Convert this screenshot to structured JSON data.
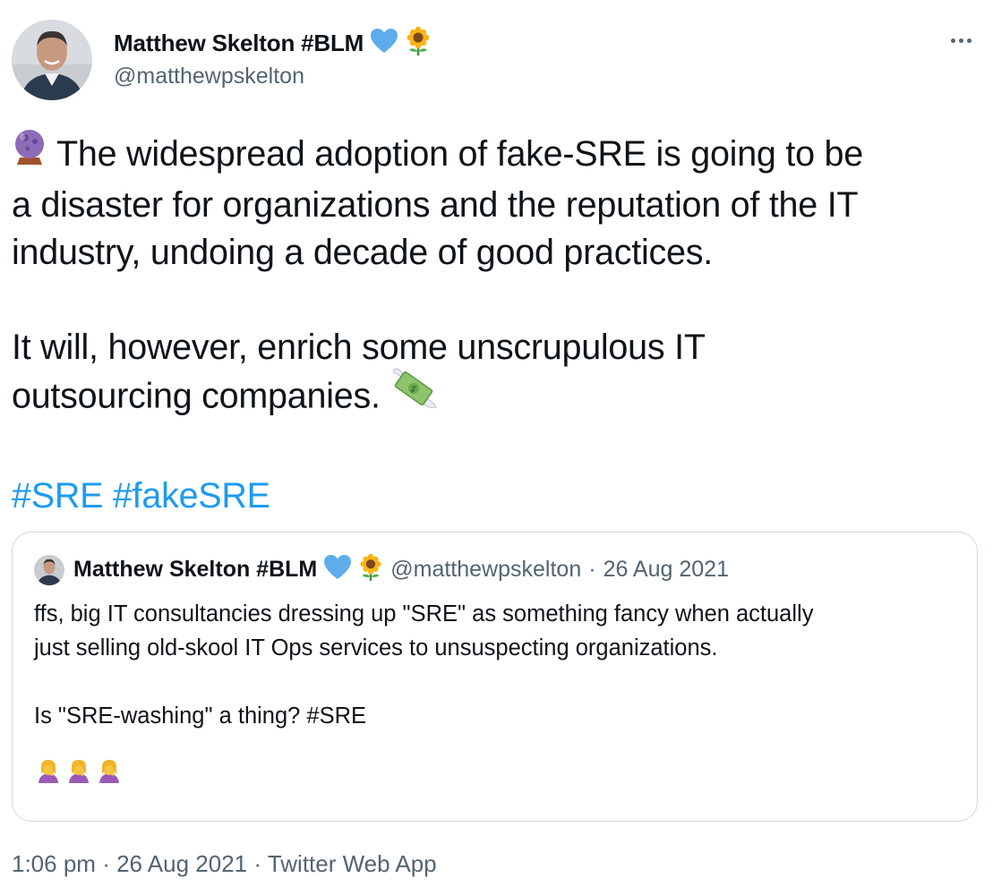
{
  "tweet": {
    "author_name": "Matthew Skelton #BLM",
    "author_handle": "@matthewpskelton",
    "author_badges": [
      "blue-heart-icon",
      "sunflower-icon"
    ],
    "lines": {
      "l1": "The widespread adoption of fake-SRE is going to be",
      "l2": "a disaster for organizations and the reputation of the IT",
      "l3": "industry, undoing a decade of good practices.",
      "l4": "It will, however, enrich some unscrupulous IT",
      "l5": "outsourcing companies."
    },
    "lead_emoji": "crystal-ball-icon",
    "trail_emoji": "money-with-wings-icon",
    "hashtags": [
      "#SRE",
      "#fakeSRE"
    ],
    "timestamp": "1:06 pm",
    "separator": "·",
    "date": "26 Aug 2021",
    "client": "Twitter Web App"
  },
  "quote": {
    "author_name": "Matthew Skelton #BLM",
    "author_handle": "@matthewpskelton",
    "separator": "·",
    "date": "26 Aug 2021",
    "lines": {
      "l1": "ffs, big IT consultancies dressing up \"SRE\" as something fancy when actually",
      "l2": "just selling old-skool IT Ops services to unsuspecting organizations.",
      "l3": "Is \"SRE-washing\" a thing? #SRE"
    },
    "emojis": [
      "woman-facepalming-icon",
      "woman-facepalming-icon",
      "woman-facepalming-icon"
    ]
  },
  "colors": {
    "link": "#1d9bf0",
    "secondary_text": "#536471",
    "primary_text": "#0f1419",
    "border": "#cfd9de"
  }
}
